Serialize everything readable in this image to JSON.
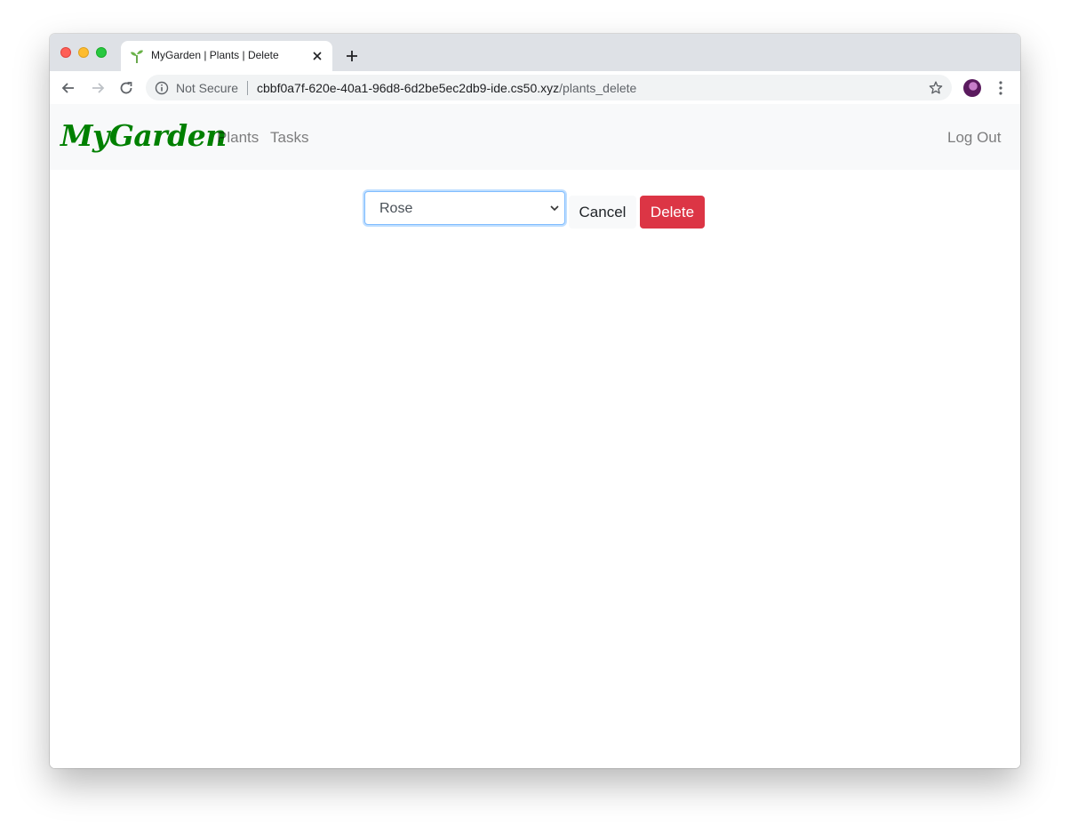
{
  "browser": {
    "tab": {
      "title": "MyGarden | Plants | Delete",
      "favicon": "sprout-icon"
    },
    "address_bar": {
      "security_label": "Not Secure",
      "url_host": "cbbf0a7f-620e-40a1-96d8-6d2be5ec2db9-ide.cs50.xyz",
      "url_path": "/plants_delete"
    }
  },
  "navbar": {
    "brand": "MyGarden",
    "links": [
      {
        "label": "Plants"
      },
      {
        "label": "Tasks"
      }
    ],
    "logout_label": "Log Out"
  },
  "form": {
    "plant_select": {
      "selected": "Rose"
    },
    "cancel_label": "Cancel",
    "delete_label": "Delete"
  },
  "colors": {
    "brand": "#008000",
    "danger": "#dc3545",
    "navbar_bg": "#f8f9fa"
  }
}
